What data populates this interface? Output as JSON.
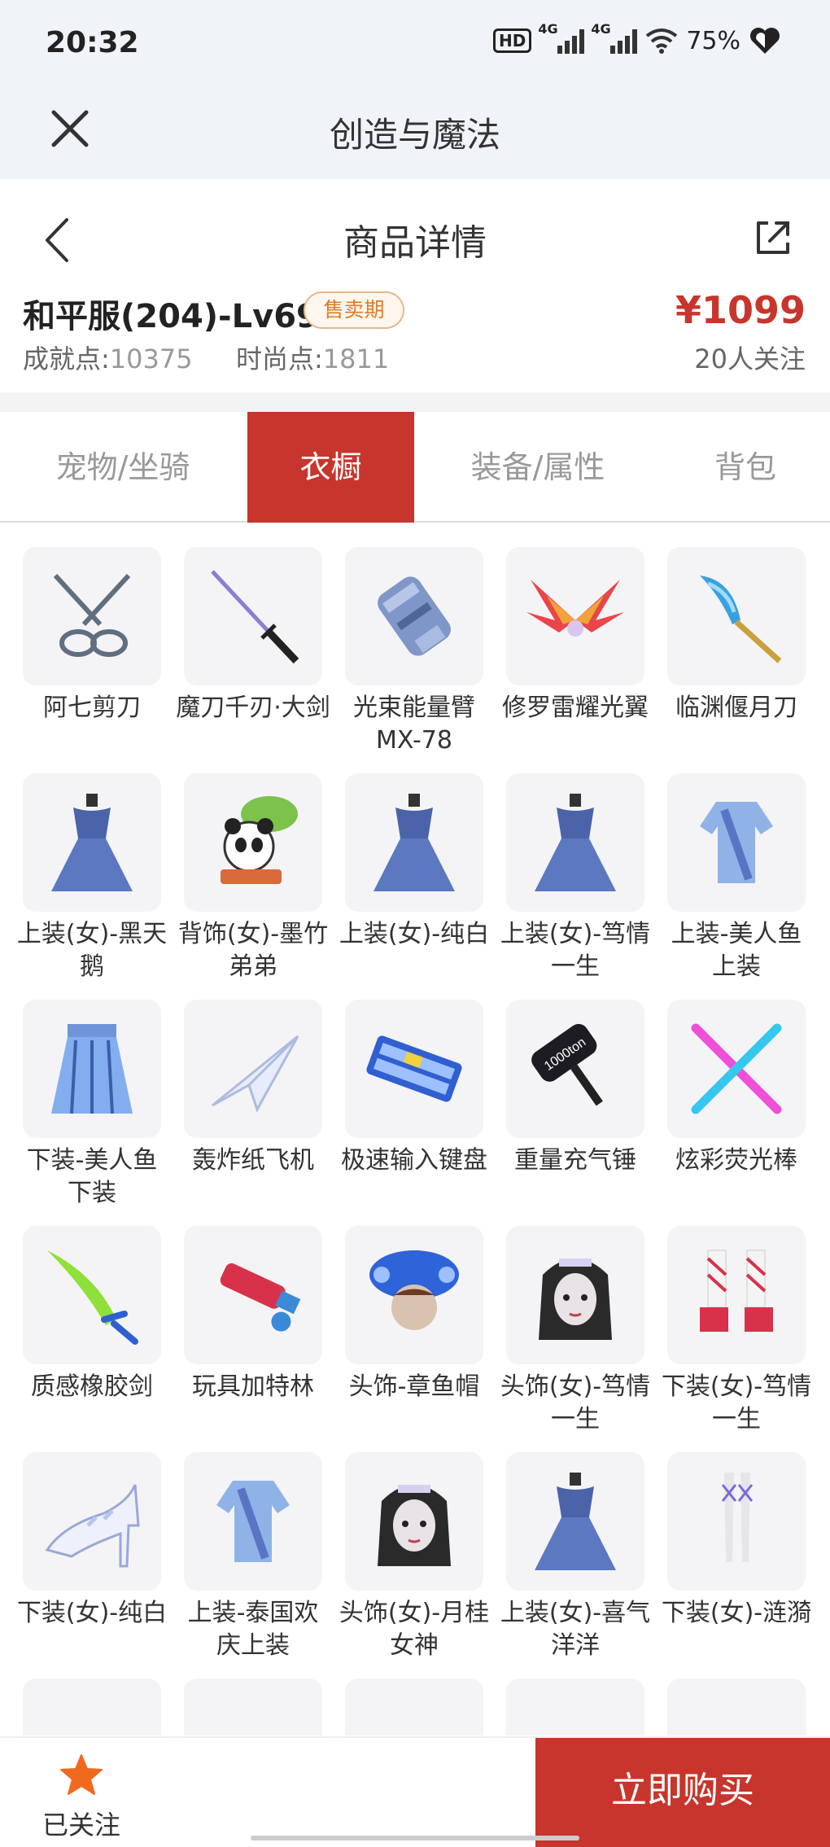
{
  "status_bar": {
    "time": "20:32",
    "hd": "HD",
    "net1": "4G",
    "net2": "4G",
    "battery": "75%"
  },
  "app_header": {
    "title": "创造与魔法"
  },
  "detail_header": {
    "title": "商品详情"
  },
  "product": {
    "name": "和平服(204)-Lv69",
    "badge": "售卖期",
    "achievement_label": "成就点:",
    "achievement_value": "10375",
    "fashion_label": "时尚点:",
    "fashion_value": "1811",
    "price": "¥1099",
    "followers": "20人关注"
  },
  "tabs": [
    {
      "label": "宠物/坐骑",
      "active": false
    },
    {
      "label": "衣橱",
      "active": true
    },
    {
      "label": "装备/属性",
      "active": false
    },
    {
      "label": "背包",
      "active": false
    }
  ],
  "items": [
    {
      "name": "阿七剪刀",
      "icon": "scissors-icon"
    },
    {
      "name": "魔刀千刃·大剑",
      "icon": "katana-icon"
    },
    {
      "name": "光束能量臂MX-78",
      "icon": "energy-arm-icon"
    },
    {
      "name": "修罗雷耀光翼",
      "icon": "wings-icon"
    },
    {
      "name": "临渊偃月刀",
      "icon": "blade-icon"
    },
    {
      "name": "上装(女)-黑天鹅",
      "icon": "dress-icon"
    },
    {
      "name": "背饰(女)-墨竹弟弟",
      "icon": "panda-icon"
    },
    {
      "name": "上装(女)-纯白",
      "icon": "dress-icon"
    },
    {
      "name": "上装(女)-笃情一生",
      "icon": "dress-icon"
    },
    {
      "name": "上装-美人鱼上装",
      "icon": "top-icon"
    },
    {
      "name": "下装-美人鱼下装",
      "icon": "skirt-icon"
    },
    {
      "name": "轰炸纸飞机",
      "icon": "paper-plane-icon"
    },
    {
      "name": "极速输入键盘",
      "icon": "keyboard-icon"
    },
    {
      "name": "重量充气锤",
      "icon": "hammer-icon"
    },
    {
      "name": "炫彩荧光棒",
      "icon": "glowsticks-icon"
    },
    {
      "name": "质感橡胶剑",
      "icon": "rubber-sword-icon"
    },
    {
      "name": "玩具加特林",
      "icon": "gatling-icon"
    },
    {
      "name": "头饰-章鱼帽",
      "icon": "octopus-hat-icon"
    },
    {
      "name": "头饰(女)-笃情一生",
      "icon": "head-icon"
    },
    {
      "name": "下装(女)-笃情一生",
      "icon": "shoes-icon"
    },
    {
      "name": "下装(女)-纯白",
      "icon": "heel-icon"
    },
    {
      "name": "上装-泰国欢庆上装",
      "icon": "top-icon"
    },
    {
      "name": "头饰(女)-月桂女神",
      "icon": "head-icon"
    },
    {
      "name": "上装(女)-喜气洋洋",
      "icon": "dress-icon"
    },
    {
      "name": "下装(女)-涟漪",
      "icon": "legs-icon"
    }
  ],
  "bottom_bar": {
    "follow_label": "已关注",
    "buy_label": "立即购买"
  },
  "colors": {
    "accent": "#c7352c",
    "badge": "#e07a24",
    "star": "#f06a1e"
  }
}
